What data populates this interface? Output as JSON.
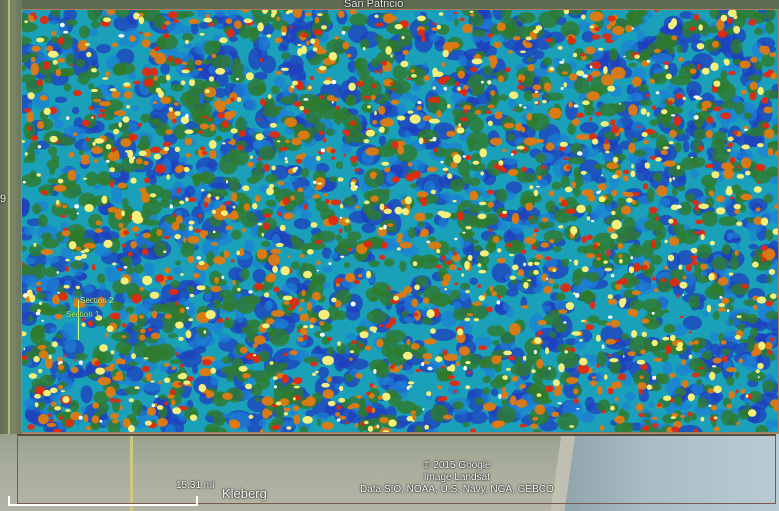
{
  "labels": {
    "place_top": "San Patricio",
    "place_bottom": "Kleberg",
    "edge_number": "9",
    "section_1": "Section 1",
    "section_2": "Section 2"
  },
  "credits": {
    "copyright": "© 2015 Google",
    "imagery": "Image Landsat",
    "data": "Data SIO, NOAA, U.S. Navy, NGA, GEBCO"
  },
  "scale": {
    "label": "15.31 mi"
  },
  "overlay": {
    "palette": [
      "#1f3fbf",
      "#1d7fd6",
      "#1aa0b8",
      "#2f7a2a",
      "#e07a10",
      "#e02a10",
      "#f5f07a",
      "#ffffff"
    ]
  }
}
